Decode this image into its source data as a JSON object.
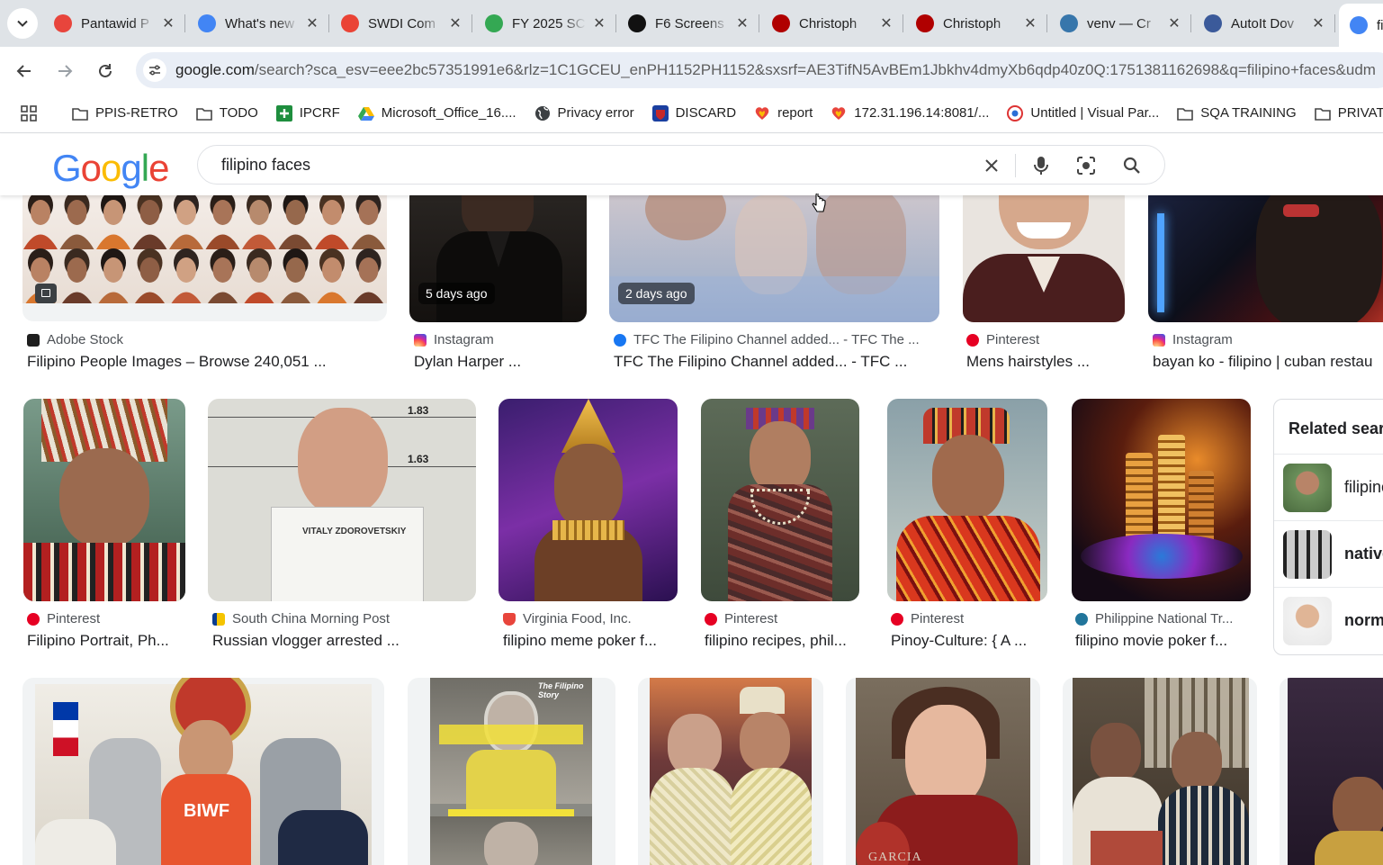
{
  "browser": {
    "tabs": [
      {
        "title": "Pantawid P",
        "favicon_color": "#e8453c"
      },
      {
        "title": "What's new",
        "favicon_color": "#4285f4"
      },
      {
        "title": "SWDI Com",
        "favicon_color": "#ea4335"
      },
      {
        "title": "FY 2025 SC",
        "favicon_color": "#34a853"
      },
      {
        "title": "F6 Screens",
        "favicon_color": "#111111"
      },
      {
        "title": "Christoph",
        "favicon_color": "#b00000"
      },
      {
        "title": "Christoph",
        "favicon_color": "#b00000"
      },
      {
        "title": "venv — Cr",
        "favicon_color": "#3776ab"
      },
      {
        "title": "AutoIt Dov",
        "favicon_color": "#3b5a9a"
      },
      {
        "title": "fi",
        "favicon_color": "#4285f4"
      }
    ],
    "url_host": "google.com",
    "url_rest": "/search?sca_esv=eee2bc57351991e6&rlz=1C1GCEU_enPH1152PH1152&sxsrf=AE3TifN5AvBEm1Jbkhv4dmyXb6qdp40z0Q:1751381162698&q=filipino+faces&udm",
    "bookmarks": [
      {
        "label": "PPIS-RETRO",
        "icon": "folder-icon"
      },
      {
        "label": "TODO",
        "icon": "folder-icon"
      },
      {
        "label": "IPCRF",
        "icon": "plus-icon"
      },
      {
        "label": "Microsoft_Office_16....",
        "icon": "drive-icon"
      },
      {
        "label": "Privacy error",
        "icon": "globe-icon"
      },
      {
        "label": "DISCARD",
        "icon": "shield-icon"
      },
      {
        "label": "report",
        "icon": "heart-icon"
      },
      {
        "label": "172.31.196.14:8081/...",
        "icon": "heart-icon"
      },
      {
        "label": "Untitled | Visual Par...",
        "icon": "vp-icon"
      },
      {
        "label": "SQA TRAINING",
        "icon": "folder-icon"
      },
      {
        "label": "PRIVATE",
        "icon": "folder-icon"
      }
    ]
  },
  "search": {
    "logo": "Google",
    "query": "filipino faces"
  },
  "row1": [
    {
      "source": "Adobe Stock",
      "title": "Filipino People Images – Browse 240,051 ...",
      "badge": "",
      "source_color": "#1e1e1e"
    },
    {
      "source": "Instagram",
      "title": "Dylan Harper ...",
      "badge": "5 days ago",
      "source_color": "#d62976"
    },
    {
      "source": "TFC The Filipino Channel added... - TFC The ...",
      "title": "TFC The Filipino Channel added... - TFC ...",
      "badge": "2 days ago",
      "source_color": "#1877f2"
    },
    {
      "source": "Pinterest",
      "title": "Mens hairstyles ...",
      "badge": "",
      "source_color": "#e60023"
    },
    {
      "source": "Instagram",
      "title": "bayan ko - filipino | cuban restau",
      "badge": "",
      "source_color": "#d62976"
    }
  ],
  "row2": [
    {
      "source": "Pinterest",
      "title": "Filipino Portrait, Ph...",
      "source_color": "#e60023"
    },
    {
      "source": "South China Morning Post",
      "title": "Russian vlogger arrested ...",
      "source_color": "#f5c400"
    },
    {
      "source": "Virginia Food, Inc.",
      "title": "filipino meme poker f...",
      "source_color": "#e8453c"
    },
    {
      "source": "Pinterest",
      "title": "filipino recipes, phil...",
      "source_color": "#e60023"
    },
    {
      "source": "Pinterest",
      "title": "Pinoy-Culture: { A ...",
      "source_color": "#e60023"
    },
    {
      "source": "Philippine National Tr...",
      "title": "filipino movie poker f...",
      "source_color": "#21759b"
    }
  ],
  "row2_images": {
    "vlogger_height_marks": [
      "1.83",
      "1.63"
    ],
    "vlogger_placard_name": "VITALY ZDOROVETSKIY"
  },
  "row3_images": {
    "police_shirt_text": "BIWF",
    "video_overlay_brand": "The Filipino Story",
    "portrait_caption": "GARCIA"
  },
  "related": {
    "title": "Related sear",
    "items": [
      "filipino",
      "native",
      "norm"
    ]
  }
}
